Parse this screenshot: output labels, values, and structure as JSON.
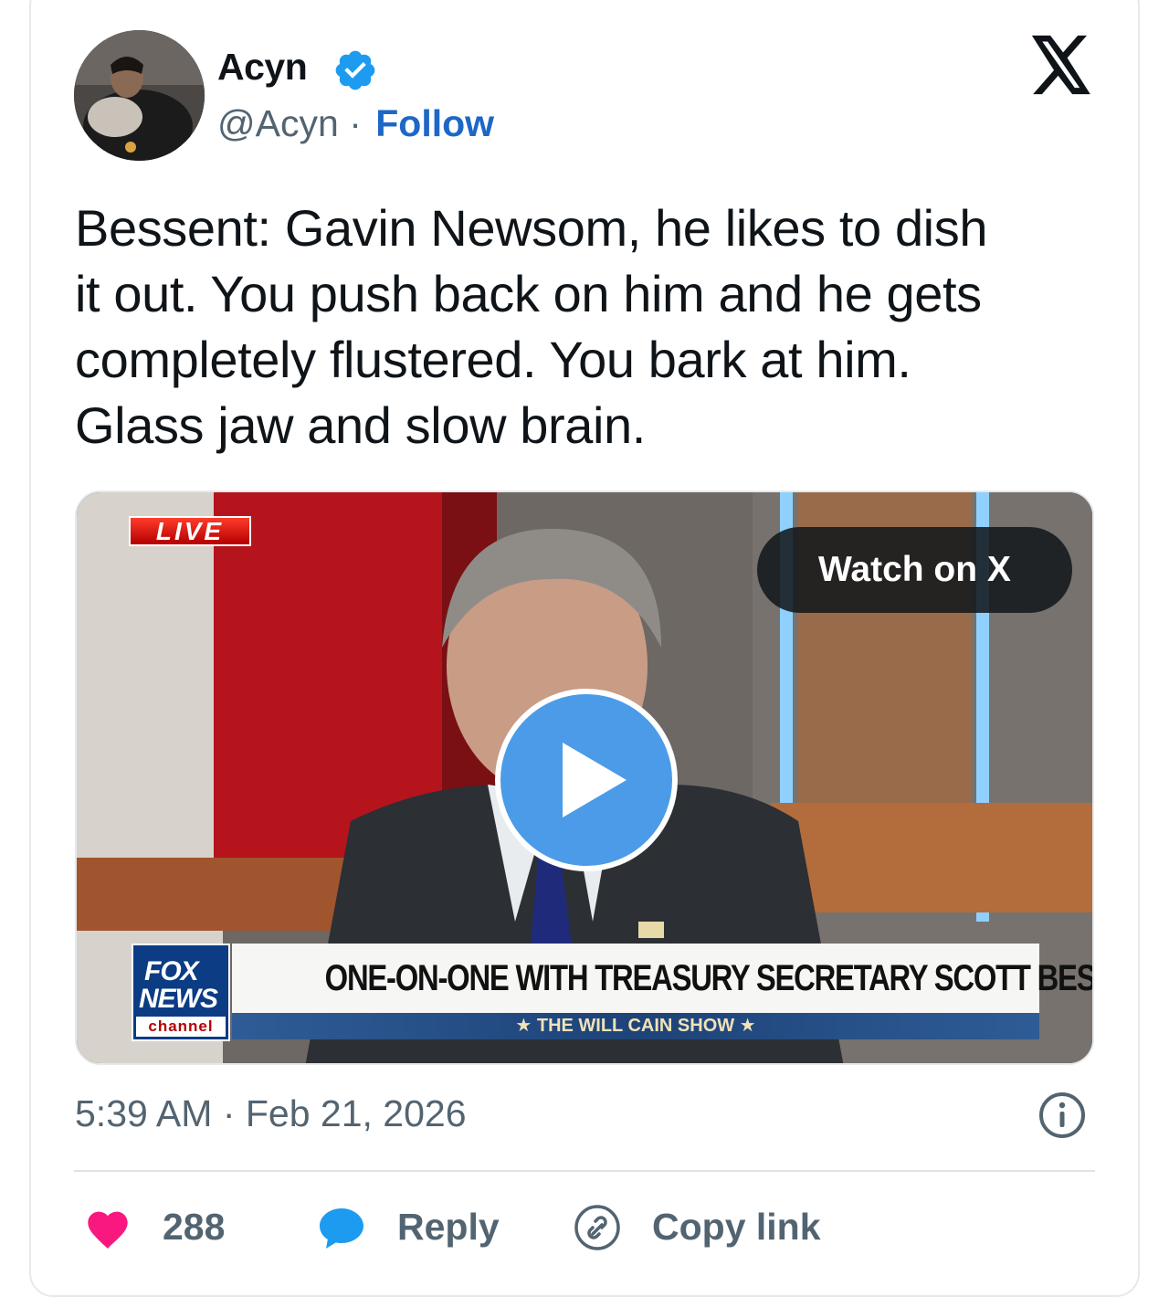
{
  "tweet": {
    "author": {
      "name": "Acyn",
      "handle": "@Acyn",
      "separator": "·",
      "follow_label": "Follow",
      "verified": true
    },
    "text": "Bessent: Gavin Newsom, he likes to dish\nit out. You push back on him and he gets\ncompletely flustered. You bark at him.\nGlass jaw and slow brain.",
    "timestamp": "5:39 AM · Feb 21, 2026"
  },
  "media": {
    "live_label": "LIVE",
    "watch_label": "Watch on X",
    "network": {
      "fox": "FOX",
      "news": "NEWS",
      "channel": "channel"
    },
    "headline": "ONE-ON-ONE WITH TREASURY SECRETARY SCOTT BESSENT",
    "show": "★ THE WILL CAIN SHOW ★"
  },
  "actions": {
    "like_count": "288",
    "reply_label": "Reply",
    "copy_label": "Copy link"
  },
  "colors": {
    "follow": "#1d67c7",
    "verified": "#1d9bf0",
    "like": "#f91880",
    "reply": "#1d9bf0",
    "play": "#4c9be8"
  },
  "icons": [
    "x-logo-icon",
    "verified-badge-icon",
    "play-icon",
    "info-icon",
    "heart-icon",
    "reply-bubble-icon",
    "link-icon"
  ]
}
